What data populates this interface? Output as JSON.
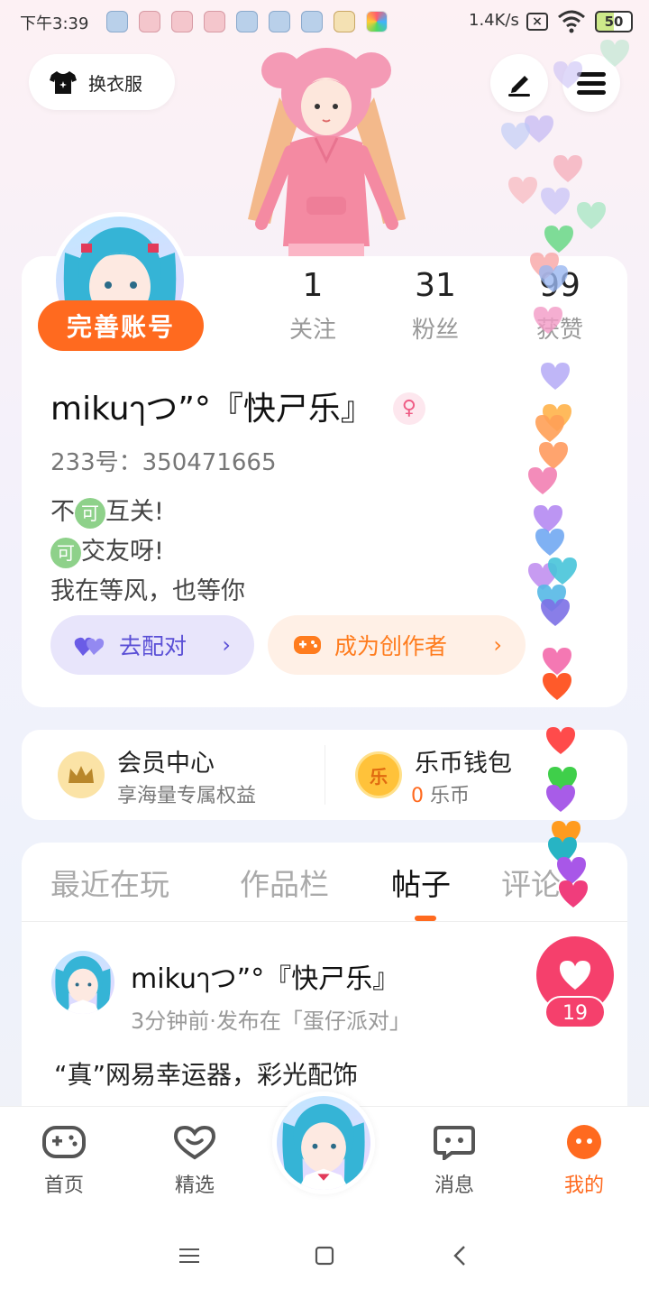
{
  "status_bar": {
    "time": "下午3:39",
    "net_speed": "1.4K/s",
    "battery": "50"
  },
  "header": {
    "outfit_label": "换衣服",
    "icons": [
      "shirt-icon",
      "edit-icon",
      "menu-icon"
    ]
  },
  "profile": {
    "complete_account_label": "完善账号",
    "stats": [
      {
        "value": "1",
        "label": "关注"
      },
      {
        "value": "31",
        "label": "粉丝"
      },
      {
        "value": "99",
        "label": "获赞"
      }
    ],
    "username": "mikuๅつ”°『快ㄕ乐』",
    "gender_symbol": "♀",
    "uid": "233号：350471665",
    "bio": {
      "line1_pre": "不",
      "line1_badge": "可",
      "line1_post": "互关!",
      "line2_badge": "可",
      "line2_post": "交友呀!",
      "line3": "我在等风，也等你"
    },
    "pair_button": "去配对",
    "creator_button": "成为创作者",
    "chevron": "›"
  },
  "wallet": {
    "vip_title": "会员中心",
    "vip_sub": "享海量专属权益",
    "coin_title": "乐币钱包",
    "coin_amount": "0",
    "coin_unit": "乐币",
    "coin_badge": "乐"
  },
  "tabs": [
    {
      "label": "最近在玩",
      "active": false
    },
    {
      "label": "作品栏",
      "active": false
    },
    {
      "label": "帖子",
      "active": true
    },
    {
      "label": "评论",
      "active": false
    }
  ],
  "post": {
    "author": "mikuๅつ”°『快ㄕ乐』",
    "meta": "3分钟前·发布在「蛋仔派对」",
    "text": "“真”网易幸运器，彩光配饰",
    "like_count": "19"
  },
  "bottom_nav": [
    {
      "label": "首页",
      "icon": "gamepad-icon",
      "active": false
    },
    {
      "label": "精选",
      "icon": "heart-icon",
      "active": false
    },
    {
      "label": "消息",
      "icon": "chat-icon",
      "active": false
    },
    {
      "label": "我的",
      "icon": "face-icon",
      "active": true
    }
  ],
  "colors": {
    "accent": "#ff6a1f",
    "like": "#f5406c",
    "pair": "#5a4fd6"
  }
}
